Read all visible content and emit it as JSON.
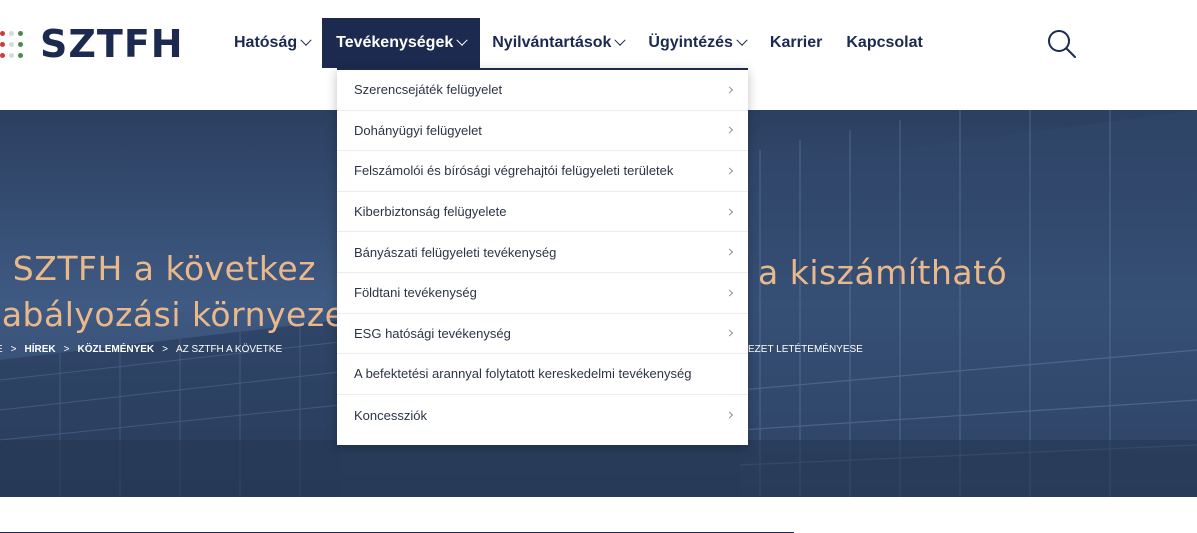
{
  "logo": {
    "text": "SZTFH",
    "dot_colors": [
      "#cf3b3b",
      "#d8d8d8",
      "#4a8a4a",
      "#cf3b3b",
      "#d8d8d8",
      "#4a8a4a",
      "#cf3b3b",
      "#d8d8d8",
      "#4a8a4a"
    ]
  },
  "nav": {
    "items": [
      {
        "label": "Hatóság",
        "has_chevron": true
      },
      {
        "label": "Tevékenységek",
        "has_chevron": true,
        "active": true
      },
      {
        "label": "Nyilvántartások",
        "has_chevron": true
      },
      {
        "label": "Ügyintézés",
        "has_chevron": true
      },
      {
        "label": "Karrier",
        "has_chevron": false
      },
      {
        "label": "Kapcsolat",
        "has_chevron": false
      }
    ],
    "search_icon": "search-icon"
  },
  "dropdown": {
    "items": [
      {
        "label": "Szerencsejáték felügyelet",
        "has_arrow": true
      },
      {
        "label": "Dohányügyi felügyelet",
        "has_arrow": true
      },
      {
        "label": "Felszámolói és bírósági végrehajtói felügyeleti területek",
        "has_arrow": true
      },
      {
        "label": "Kiberbiztonság felügyelete",
        "has_arrow": true
      },
      {
        "label": "Bányászati felügyeleti tevékenység",
        "has_arrow": true
      },
      {
        "label": "Földtani tevékenység",
        "has_arrow": true
      },
      {
        "label": "ESG hatósági tevékenység",
        "has_arrow": true
      },
      {
        "label": "A befektetési arannyal folytatott kereskedelmi tevékenység",
        "has_arrow": false
      },
      {
        "label": "Koncessziók",
        "has_arrow": true
      }
    ]
  },
  "hero": {
    "title_line1_left": "z SZTFH a következ",
    "title_line1_right": "a kiszámítható",
    "title_line2_left": "zabályozási környeze",
    "breadcrumbs": {
      "first": "E",
      "hirek": "HÍREK",
      "kozlemenyek": "KÖZLEMÉNYEK",
      "current_left": "AZ SZTFH A KÖVETKE",
      "current_right": "EZET LETÉTEMÉNYESE"
    }
  },
  "colors": {
    "brand_navy": "#1b2a4e",
    "hero_title": "#e9b98c"
  }
}
